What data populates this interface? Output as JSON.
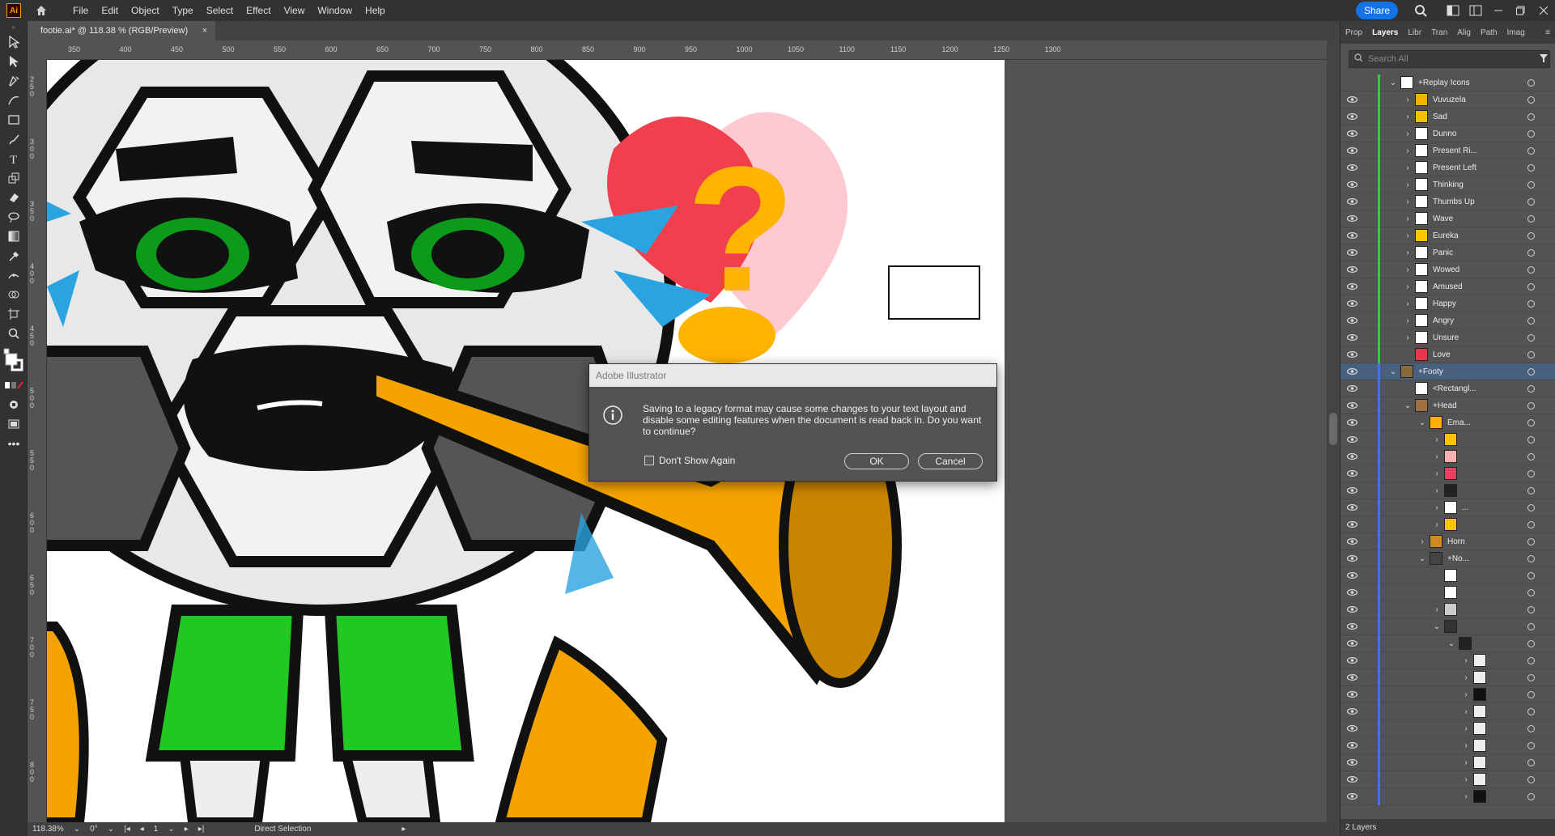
{
  "app": {
    "logo": "Ai",
    "menus": [
      "File",
      "Edit",
      "Object",
      "Type",
      "Select",
      "Effect",
      "View",
      "Window",
      "Help"
    ],
    "share_label": "Share"
  },
  "document_tab": {
    "title": "footie.ai* @ 118.38 % (RGB/Preview)",
    "close": "×"
  },
  "ruler": {
    "h_ticks": [
      "350",
      "400",
      "450",
      "500",
      "550",
      "600",
      "650",
      "700",
      "750",
      "800",
      "850",
      "900",
      "950",
      "1000",
      "1050",
      "1100",
      "1150",
      "1200",
      "1250",
      "1300"
    ],
    "v_ticks": [
      "2 5 0",
      "3 0 0",
      "3 5 0",
      "4 0 0",
      "4 5 0",
      "5 0 0",
      "5 5 0",
      "6 0 0",
      "6 5 0",
      "7 0 0",
      "7 5 0",
      "8 0 0"
    ]
  },
  "panel": {
    "tabs": [
      "Prop",
      "Layers",
      "Libr",
      "Tran",
      "Alig",
      "Path",
      "Imag"
    ],
    "active_tab": "Layers",
    "search_placeholder": "Search All",
    "footer": "2 Layers",
    "layers": [
      {
        "name": "+Replay Icons",
        "indent": 0,
        "arrow": "down",
        "bar": "#3ec43e",
        "eye": false,
        "thumb": "#ffffff"
      },
      {
        "name": "Vuvuzela",
        "indent": 1,
        "arrow": "right",
        "bar": "#3ec43e",
        "eye": true,
        "thumb": "#f2b400"
      },
      {
        "name": "Sad",
        "indent": 1,
        "arrow": "right",
        "bar": "#3ec43e",
        "eye": true,
        "thumb": "#f2c000"
      },
      {
        "name": "Dunno",
        "indent": 1,
        "arrow": "right",
        "bar": "#3ec43e",
        "eye": true,
        "thumb": "#ffffff"
      },
      {
        "name": "Present Ri...",
        "indent": 1,
        "arrow": "right",
        "bar": "#3ec43e",
        "eye": true,
        "thumb": "#ffffff"
      },
      {
        "name": "Present Left",
        "indent": 1,
        "arrow": "right",
        "bar": "#3ec43e",
        "eye": true,
        "thumb": "#ffffff"
      },
      {
        "name": "Thinking",
        "indent": 1,
        "arrow": "right",
        "bar": "#3ec43e",
        "eye": true,
        "thumb": "#ffffff"
      },
      {
        "name": "Thumbs Up",
        "indent": 1,
        "arrow": "right",
        "bar": "#3ec43e",
        "eye": true,
        "thumb": "#ffffff"
      },
      {
        "name": "Wave",
        "indent": 1,
        "arrow": "right",
        "bar": "#3ec43e",
        "eye": true,
        "thumb": "#ffffff"
      },
      {
        "name": "Eureka",
        "indent": 1,
        "arrow": "right",
        "bar": "#3ec43e",
        "eye": true,
        "thumb": "#ffc400"
      },
      {
        "name": "Panic",
        "indent": 1,
        "arrow": "right",
        "bar": "#3ec43e",
        "eye": true,
        "thumb": "#ffffff"
      },
      {
        "name": "Wowed",
        "indent": 1,
        "arrow": "right",
        "bar": "#3ec43e",
        "eye": true,
        "thumb": "#ffffff"
      },
      {
        "name": "Amused",
        "indent": 1,
        "arrow": "right",
        "bar": "#3ec43e",
        "eye": true,
        "thumb": "#ffffff"
      },
      {
        "name": "Happy",
        "indent": 1,
        "arrow": "right",
        "bar": "#3ec43e",
        "eye": true,
        "thumb": "#ffffff"
      },
      {
        "name": "Angry",
        "indent": 1,
        "arrow": "right",
        "bar": "#3ec43e",
        "eye": true,
        "thumb": "#ffffff"
      },
      {
        "name": "Unsure",
        "indent": 1,
        "arrow": "right",
        "bar": "#3ec43e",
        "eye": true,
        "thumb": "#ffffff"
      },
      {
        "name": "Love",
        "indent": 1,
        "arrow": "",
        "bar": "#3ec43e",
        "eye": true,
        "thumb": "#e8364a"
      },
      {
        "name": "+Footy",
        "indent": 0,
        "arrow": "down",
        "bar": "#4a6cff",
        "eye": true,
        "thumb": "#8a6a3a",
        "selected": true
      },
      {
        "name": "<Rectangl...",
        "indent": 1,
        "arrow": "",
        "bar": "#4a6cff",
        "eye": true,
        "thumb": "#ffffff"
      },
      {
        "name": "+Head",
        "indent": 1,
        "arrow": "down",
        "bar": "#4a6cff",
        "eye": true,
        "thumb": "#a07040"
      },
      {
        "name": "Ema...",
        "indent": 2,
        "arrow": "down",
        "bar": "#4a6cff",
        "eye": true,
        "thumb": "#ffb000"
      },
      {
        "name": "",
        "indent": 3,
        "arrow": "right",
        "bar": "#4a6cff",
        "eye": true,
        "thumb": "#ffc400"
      },
      {
        "name": "",
        "indent": 3,
        "arrow": "right",
        "bar": "#4a6cff",
        "eye": true,
        "thumb": "#f5b0b0"
      },
      {
        "name": "",
        "indent": 3,
        "arrow": "right",
        "bar": "#4a6cff",
        "eye": true,
        "thumb": "#e84060"
      },
      {
        "name": "",
        "indent": 3,
        "arrow": "right",
        "bar": "#4a6cff",
        "eye": true,
        "thumb": "#222222"
      },
      {
        "name": "...",
        "indent": 3,
        "arrow": "right",
        "bar": "#4a6cff",
        "eye": true,
        "thumb": "#ffffff"
      },
      {
        "name": "",
        "indent": 3,
        "arrow": "right",
        "bar": "#4a6cff",
        "eye": true,
        "thumb": "#ffc400"
      },
      {
        "name": "Horn",
        "indent": 2,
        "arrow": "right",
        "bar": "#4a6cff",
        "eye": true,
        "thumb": "#d08a20"
      },
      {
        "name": "+No...",
        "indent": 2,
        "arrow": "down",
        "bar": "#4a6cff",
        "eye": true,
        "thumb": "#444444"
      },
      {
        "name": "",
        "indent": 3,
        "arrow": "",
        "bar": "#4a6cff",
        "eye": true,
        "thumb": "#ffffff"
      },
      {
        "name": "",
        "indent": 3,
        "arrow": "",
        "bar": "#4a6cff",
        "eye": true,
        "thumb": "#ffffff"
      },
      {
        "name": "",
        "indent": 3,
        "arrow": "right",
        "bar": "#4a6cff",
        "eye": true,
        "thumb": "#cccccc"
      },
      {
        "name": "",
        "indent": 3,
        "arrow": "down",
        "bar": "#4a6cff",
        "eye": true,
        "thumb": "#333333"
      },
      {
        "name": "",
        "indent": 4,
        "arrow": "down",
        "bar": "#4a6cff",
        "eye": true,
        "thumb": "#222222"
      },
      {
        "name": "",
        "indent": 5,
        "arrow": "right",
        "bar": "#4a6cff",
        "eye": true,
        "thumb": "#eeeeee"
      },
      {
        "name": "",
        "indent": 5,
        "arrow": "right",
        "bar": "#4a6cff",
        "eye": true,
        "thumb": "#eeeeee"
      },
      {
        "name": "",
        "indent": 5,
        "arrow": "right",
        "bar": "#4a6cff",
        "eye": true,
        "thumb": "#111111"
      },
      {
        "name": "",
        "indent": 5,
        "arrow": "right",
        "bar": "#4a6cff",
        "eye": true,
        "thumb": "#eeeeee"
      },
      {
        "name": "",
        "indent": 5,
        "arrow": "right",
        "bar": "#4a6cff",
        "eye": true,
        "thumb": "#eeeeee"
      },
      {
        "name": "",
        "indent": 5,
        "arrow": "right",
        "bar": "#4a6cff",
        "eye": true,
        "thumb": "#eeeeee"
      },
      {
        "name": "",
        "indent": 5,
        "arrow": "right",
        "bar": "#4a6cff",
        "eye": true,
        "thumb": "#eeeeee"
      },
      {
        "name": "",
        "indent": 5,
        "arrow": "right",
        "bar": "#4a6cff",
        "eye": true,
        "thumb": "#eeeeee"
      },
      {
        "name": "",
        "indent": 5,
        "arrow": "right",
        "bar": "#4a6cff",
        "eye": true,
        "thumb": "#111111"
      }
    ]
  },
  "status": {
    "zoom": "118.38%",
    "rotation": "0°",
    "artboard": "1",
    "tool": "Direct Selection"
  },
  "dialog": {
    "title": "Adobe Illustrator",
    "message": "Saving to a legacy format may cause some changes to your text layout and disable some editing features when the document is read back in. Do you want to continue?",
    "checkbox_label": "Don't Show Again",
    "ok_label": "OK",
    "cancel_label": "Cancel"
  }
}
